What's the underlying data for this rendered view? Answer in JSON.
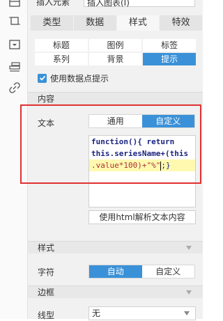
{
  "top": {
    "label": "插入元素",
    "select_value": "插入图表(I)"
  },
  "main_tabs": [
    {
      "label": "类型"
    },
    {
      "label": "数据"
    },
    {
      "label": "样式",
      "active": true
    },
    {
      "label": "特效"
    }
  ],
  "sub_tabs": [
    {
      "label": "标题"
    },
    {
      "label": "图例"
    },
    {
      "label": "标签"
    },
    {
      "label": "系列"
    },
    {
      "label": "背景"
    },
    {
      "label": "提示",
      "active": true
    }
  ],
  "tooltip_checkbox": {
    "label": "使用数据点提示",
    "checked": true
  },
  "content_section": {
    "title": "内容"
  },
  "text_row": {
    "label": "文本",
    "options": [
      "通用",
      "自定义"
    ],
    "selected": "自定义"
  },
  "code_editor": {
    "line1": "function(){ return",
    "line2": "this.seriesName+(this",
    "line3_a": ".value*100)+\"%\"",
    "line3_b": ";}"
  },
  "html_button": {
    "label": "使用html解析文本内容"
  },
  "style_section": {
    "title": "样式"
  },
  "font_row": {
    "label": "字符",
    "options": [
      "自动",
      "自定义"
    ],
    "selected": "自动"
  },
  "border_section": {
    "title": "边框"
  },
  "line_type_row": {
    "label": "线型",
    "value": "无"
  },
  "colors": {
    "accent": "#3a91d8",
    "highlight_box": "#e03131"
  },
  "icons": [
    "table-icon",
    "frame-icon",
    "dropdown-icon",
    "layers-icon",
    "link-icon"
  ]
}
